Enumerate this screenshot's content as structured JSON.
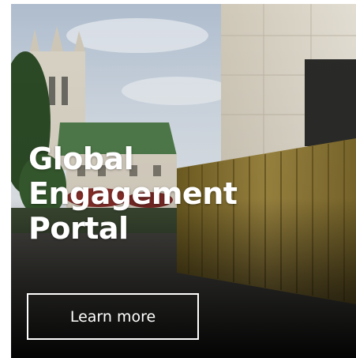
{
  "card": {
    "headline_line1": "Global",
    "headline_line2": "Engagement",
    "headline_line3": "Portal",
    "cta_label": "Learn more"
  },
  "colors": {
    "text": "#ffffff",
    "button_border": "#ffffff",
    "container_gold": "#8a7430",
    "sky": "#c9d3df",
    "stone": "#d8d2c4"
  }
}
